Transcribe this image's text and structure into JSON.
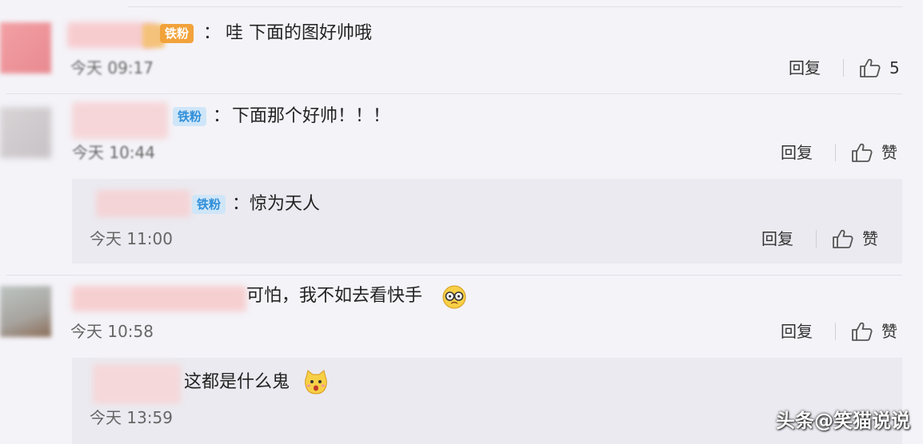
{
  "comments": [
    {
      "badge": "铁粉",
      "separator": "：",
      "text": "哇 下面的图好帅哦",
      "time": "今天 09:17",
      "reply_label": "回复",
      "like_label": "5"
    },
    {
      "badge": "铁粉",
      "separator": "：",
      "text": "下面那个好帅！！！",
      "time": "今天 10:44",
      "reply_label": "回复",
      "like_label": "赞",
      "replies": [
        {
          "badge": "铁粉",
          "separator": "：",
          "text": "惊为天人",
          "time": "今天 11:00",
          "reply_label": "回复",
          "like_label": "赞"
        }
      ]
    },
    {
      "text": "可怕，我不如去看快手",
      "time": "今天 10:58",
      "reply_label": "回复",
      "like_label": "赞",
      "replies": [
        {
          "text": "这都是什么鬼",
          "time": "今天 13:59"
        }
      ]
    }
  ],
  "watermark": "头条@笑猫说说"
}
